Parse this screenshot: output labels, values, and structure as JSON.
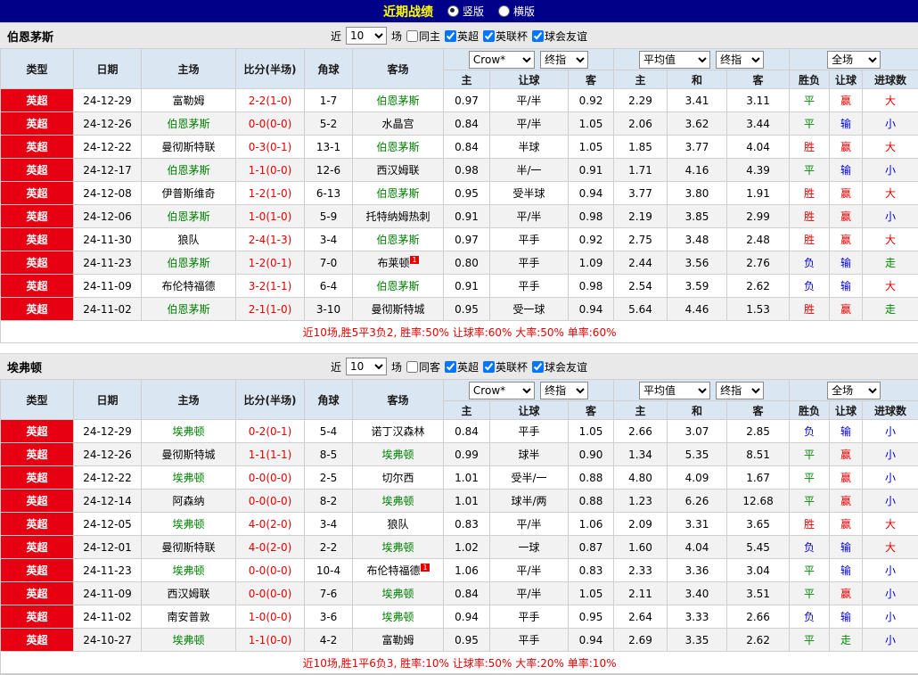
{
  "topbar": {
    "title": "近期战绩",
    "radios": [
      {
        "label": "竖版",
        "checked": true
      },
      {
        "label": "横版",
        "checked": false
      }
    ]
  },
  "colors": {
    "topbar_bg": "#000089",
    "title_yellow": "#ffff00",
    "header_bg": "#dbe6f3",
    "league_red": "#e60012",
    "subject_team_green": "#008000",
    "win_red": "#e60000",
    "lose_blue": "#0000d0",
    "draw_green": "#008800"
  },
  "sections": [
    {
      "team": "伯恩茅斯",
      "filter": {
        "prefix": "近",
        "count_value": "10",
        "suffix": "场",
        "same_checkbox": {
          "label": "同主",
          "checked": false
        },
        "league_checkboxes": [
          {
            "label": "英超",
            "checked": true
          },
          {
            "label": "英联杯",
            "checked": true
          },
          {
            "label": "球会友谊",
            "checked": true
          }
        ]
      },
      "table": {
        "columns": {
          "type": "类型",
          "date": "日期",
          "home": "主场",
          "score": "比分(半场)",
          "corner": "角球",
          "away": "客场",
          "odds_group_selects": [
            "Crow*",
            "终指"
          ],
          "avg_group_selects": [
            "平均值",
            "终指"
          ],
          "full_group_selects": [
            "全场"
          ],
          "odds_sub": [
            "主",
            "让球",
            "客"
          ],
          "avg_sub": [
            "主",
            "和",
            "客"
          ],
          "full_sub": [
            "胜负",
            "让球",
            "进球数"
          ]
        },
        "rows": [
          {
            "league": "英超",
            "date": "24-12-29",
            "home": "富勒姆",
            "home_is_subject": false,
            "score": "2-2(1-0)",
            "corner": "1-7",
            "away": "伯恩茅斯",
            "away_is_subject": true,
            "away_badge": "",
            "odds": [
              "0.97",
              "平/半",
              "0.92"
            ],
            "avg": [
              "2.29",
              "3.41",
              "3.11"
            ],
            "results": [
              "平",
              "赢",
              "大"
            ],
            "result_colors": [
              "green",
              "red",
              "red"
            ]
          },
          {
            "league": "英超",
            "date": "24-12-26",
            "home": "伯恩茅斯",
            "home_is_subject": true,
            "score": "0-0(0-0)",
            "corner": "5-2",
            "away": "水晶宫",
            "away_is_subject": false,
            "away_badge": "",
            "odds": [
              "0.84",
              "平/半",
              "1.05"
            ],
            "avg": [
              "2.06",
              "3.62",
              "3.44"
            ],
            "results": [
              "平",
              "输",
              "小"
            ],
            "result_colors": [
              "green",
              "blue",
              "blue"
            ]
          },
          {
            "league": "英超",
            "date": "24-12-22",
            "home": "曼彻斯特联",
            "home_is_subject": false,
            "score": "0-3(0-1)",
            "corner": "13-1",
            "away": "伯恩茅斯",
            "away_is_subject": true,
            "away_badge": "",
            "odds": [
              "0.84",
              "半球",
              "1.05"
            ],
            "avg": [
              "1.85",
              "3.77",
              "4.04"
            ],
            "results": [
              "胜",
              "赢",
              "大"
            ],
            "result_colors": [
              "red",
              "red",
              "red"
            ]
          },
          {
            "league": "英超",
            "date": "24-12-17",
            "home": "伯恩茅斯",
            "home_is_subject": true,
            "score": "1-1(0-0)",
            "corner": "12-6",
            "away": "西汉姆联",
            "away_is_subject": false,
            "away_badge": "",
            "odds": [
              "0.98",
              "半/一",
              "0.91"
            ],
            "avg": [
              "1.71",
              "4.16",
              "4.39"
            ],
            "results": [
              "平",
              "输",
              "小"
            ],
            "result_colors": [
              "green",
              "blue",
              "blue"
            ]
          },
          {
            "league": "英超",
            "date": "24-12-08",
            "home": "伊普斯维奇",
            "home_is_subject": false,
            "score": "1-2(1-0)",
            "corner": "6-13",
            "away": "伯恩茅斯",
            "away_is_subject": true,
            "away_badge": "",
            "odds": [
              "0.95",
              "受半球",
              "0.94"
            ],
            "avg": [
              "3.77",
              "3.80",
              "1.91"
            ],
            "results": [
              "胜",
              "赢",
              "大"
            ],
            "result_colors": [
              "red",
              "red",
              "red"
            ]
          },
          {
            "league": "英超",
            "date": "24-12-06",
            "home": "伯恩茅斯",
            "home_is_subject": true,
            "score": "1-0(1-0)",
            "corner": "5-9",
            "away": "托特纳姆热刺",
            "away_is_subject": false,
            "away_badge": "",
            "odds": [
              "0.91",
              "平/半",
              "0.98"
            ],
            "avg": [
              "2.19",
              "3.85",
              "2.99"
            ],
            "results": [
              "胜",
              "赢",
              "小"
            ],
            "result_colors": [
              "red",
              "red",
              "blue"
            ]
          },
          {
            "league": "英超",
            "date": "24-11-30",
            "home": "狼队",
            "home_is_subject": false,
            "score": "2-4(1-3)",
            "corner": "3-4",
            "away": "伯恩茅斯",
            "away_is_subject": true,
            "away_badge": "",
            "odds": [
              "0.97",
              "平手",
              "0.92"
            ],
            "avg": [
              "2.75",
              "3.48",
              "2.48"
            ],
            "results": [
              "胜",
              "赢",
              "大"
            ],
            "result_colors": [
              "red",
              "red",
              "red"
            ]
          },
          {
            "league": "英超",
            "date": "24-11-23",
            "home": "伯恩茅斯",
            "home_is_subject": true,
            "score": "1-2(0-1)",
            "corner": "7-0",
            "away": "布莱顿",
            "away_is_subject": false,
            "away_badge": "1",
            "odds": [
              "0.80",
              "平手",
              "1.09"
            ],
            "avg": [
              "2.44",
              "3.56",
              "2.76"
            ],
            "results": [
              "负",
              "输",
              "走"
            ],
            "result_colors": [
              "blue",
              "blue",
              "green"
            ]
          },
          {
            "league": "英超",
            "date": "24-11-09",
            "home": "布伦特福德",
            "home_is_subject": false,
            "score": "3-2(1-1)",
            "corner": "6-4",
            "away": "伯恩茅斯",
            "away_is_subject": true,
            "away_badge": "",
            "odds": [
              "0.91",
              "平手",
              "0.98"
            ],
            "avg": [
              "2.54",
              "3.59",
              "2.62"
            ],
            "results": [
              "负",
              "输",
              "大"
            ],
            "result_colors": [
              "blue",
              "blue",
              "red"
            ]
          },
          {
            "league": "英超",
            "date": "24-11-02",
            "home": "伯恩茅斯",
            "home_is_subject": true,
            "score": "2-1(1-0)",
            "corner": "3-10",
            "away": "曼彻斯特城",
            "away_is_subject": false,
            "away_badge": "",
            "odds": [
              "0.95",
              "受一球",
              "0.94"
            ],
            "avg": [
              "5.64",
              "4.46",
              "1.53"
            ],
            "results": [
              "胜",
              "赢",
              "走"
            ],
            "result_colors": [
              "red",
              "red",
              "green"
            ]
          }
        ],
        "summary": "近10场,胜5平3负2, 胜率:50% 让球率:60% 大率:50% 单率:60%"
      }
    },
    {
      "team": "埃弗顿",
      "filter": {
        "prefix": "近",
        "count_value": "10",
        "suffix": "场",
        "same_checkbox": {
          "label": "同客",
          "checked": false
        },
        "league_checkboxes": [
          {
            "label": "英超",
            "checked": true
          },
          {
            "label": "英联杯",
            "checked": true
          },
          {
            "label": "球会友谊",
            "checked": true
          }
        ]
      },
      "table": {
        "columns": {
          "type": "类型",
          "date": "日期",
          "home": "主场",
          "score": "比分(半场)",
          "corner": "角球",
          "away": "客场",
          "odds_group_selects": [
            "Crow*",
            "终指"
          ],
          "avg_group_selects": [
            "平均值",
            "终指"
          ],
          "full_group_selects": [
            "全场"
          ],
          "odds_sub": [
            "主",
            "让球",
            "客"
          ],
          "avg_sub": [
            "主",
            "和",
            "客"
          ],
          "full_sub": [
            "胜负",
            "让球",
            "进球数"
          ]
        },
        "rows": [
          {
            "league": "英超",
            "date": "24-12-29",
            "home": "埃弗顿",
            "home_is_subject": true,
            "score": "0-2(0-1)",
            "corner": "5-4",
            "away": "诺丁汉森林",
            "away_is_subject": false,
            "away_badge": "",
            "odds": [
              "0.84",
              "平手",
              "1.05"
            ],
            "avg": [
              "2.66",
              "3.07",
              "2.85"
            ],
            "results": [
              "负",
              "输",
              "小"
            ],
            "result_colors": [
              "blue",
              "blue",
              "blue"
            ]
          },
          {
            "league": "英超",
            "date": "24-12-26",
            "home": "曼彻斯特城",
            "home_is_subject": false,
            "score": "1-1(1-1)",
            "corner": "8-5",
            "away": "埃弗顿",
            "away_is_subject": true,
            "away_badge": "",
            "odds": [
              "0.99",
              "球半",
              "0.90"
            ],
            "avg": [
              "1.34",
              "5.35",
              "8.51"
            ],
            "results": [
              "平",
              "赢",
              "小"
            ],
            "result_colors": [
              "green",
              "red",
              "blue"
            ]
          },
          {
            "league": "英超",
            "date": "24-12-22",
            "home": "埃弗顿",
            "home_is_subject": true,
            "score": "0-0(0-0)",
            "corner": "2-5",
            "away": "切尔西",
            "away_is_subject": false,
            "away_badge": "",
            "odds": [
              "1.01",
              "受半/一",
              "0.88"
            ],
            "avg": [
              "4.80",
              "4.09",
              "1.67"
            ],
            "results": [
              "平",
              "赢",
              "小"
            ],
            "result_colors": [
              "green",
              "red",
              "blue"
            ]
          },
          {
            "league": "英超",
            "date": "24-12-14",
            "home": "阿森纳",
            "home_is_subject": false,
            "score": "0-0(0-0)",
            "corner": "8-2",
            "away": "埃弗顿",
            "away_is_subject": true,
            "away_badge": "",
            "odds": [
              "1.01",
              "球半/两",
              "0.88"
            ],
            "avg": [
              "1.23",
              "6.26",
              "12.68"
            ],
            "results": [
              "平",
              "赢",
              "小"
            ],
            "result_colors": [
              "green",
              "red",
              "blue"
            ]
          },
          {
            "league": "英超",
            "date": "24-12-05",
            "home": "埃弗顿",
            "home_is_subject": true,
            "score": "4-0(2-0)",
            "corner": "3-4",
            "away": "狼队",
            "away_is_subject": false,
            "away_badge": "",
            "odds": [
              "0.83",
              "平/半",
              "1.06"
            ],
            "avg": [
              "2.09",
              "3.31",
              "3.65"
            ],
            "results": [
              "胜",
              "赢",
              "大"
            ],
            "result_colors": [
              "red",
              "red",
              "red"
            ]
          },
          {
            "league": "英超",
            "date": "24-12-01",
            "home": "曼彻斯特联",
            "home_is_subject": false,
            "score": "4-0(2-0)",
            "corner": "2-2",
            "away": "埃弗顿",
            "away_is_subject": true,
            "away_badge": "",
            "odds": [
              "1.02",
              "一球",
              "0.87"
            ],
            "avg": [
              "1.60",
              "4.04",
              "5.45"
            ],
            "results": [
              "负",
              "输",
              "大"
            ],
            "result_colors": [
              "blue",
              "blue",
              "red"
            ]
          },
          {
            "league": "英超",
            "date": "24-11-23",
            "home": "埃弗顿",
            "home_is_subject": true,
            "score": "0-0(0-0)",
            "corner": "10-4",
            "away": "布伦特福德",
            "away_is_subject": false,
            "away_badge": "1",
            "odds": [
              "1.06",
              "平/半",
              "0.83"
            ],
            "avg": [
              "2.33",
              "3.36",
              "3.04"
            ],
            "results": [
              "平",
              "输",
              "小"
            ],
            "result_colors": [
              "green",
              "blue",
              "blue"
            ]
          },
          {
            "league": "英超",
            "date": "24-11-09",
            "home": "西汉姆联",
            "home_is_subject": false,
            "score": "0-0(0-0)",
            "corner": "7-6",
            "away": "埃弗顿",
            "away_is_subject": true,
            "away_badge": "",
            "odds": [
              "0.84",
              "平/半",
              "1.05"
            ],
            "avg": [
              "2.11",
              "3.40",
              "3.51"
            ],
            "results": [
              "平",
              "赢",
              "小"
            ],
            "result_colors": [
              "green",
              "red",
              "blue"
            ]
          },
          {
            "league": "英超",
            "date": "24-11-02",
            "home": "南安普敦",
            "home_is_subject": false,
            "score": "1-0(0-0)",
            "corner": "3-6",
            "away": "埃弗顿",
            "away_is_subject": true,
            "away_badge": "",
            "odds": [
              "0.94",
              "平手",
              "0.95"
            ],
            "avg": [
              "2.64",
              "3.33",
              "2.66"
            ],
            "results": [
              "负",
              "输",
              "小"
            ],
            "result_colors": [
              "blue",
              "blue",
              "blue"
            ]
          },
          {
            "league": "英超",
            "date": "24-10-27",
            "home": "埃弗顿",
            "home_is_subject": true,
            "score": "1-1(0-0)",
            "corner": "4-2",
            "away": "富勒姆",
            "away_is_subject": false,
            "away_badge": "",
            "odds": [
              "0.95",
              "平手",
              "0.94"
            ],
            "avg": [
              "2.69",
              "3.35",
              "2.62"
            ],
            "results": [
              "平",
              "走",
              "小"
            ],
            "result_colors": [
              "green",
              "green",
              "blue"
            ]
          }
        ],
        "summary": "近10场,胜1平6负3, 胜率:10% 让球率:50% 大率:20% 单率:10%"
      }
    }
  ]
}
